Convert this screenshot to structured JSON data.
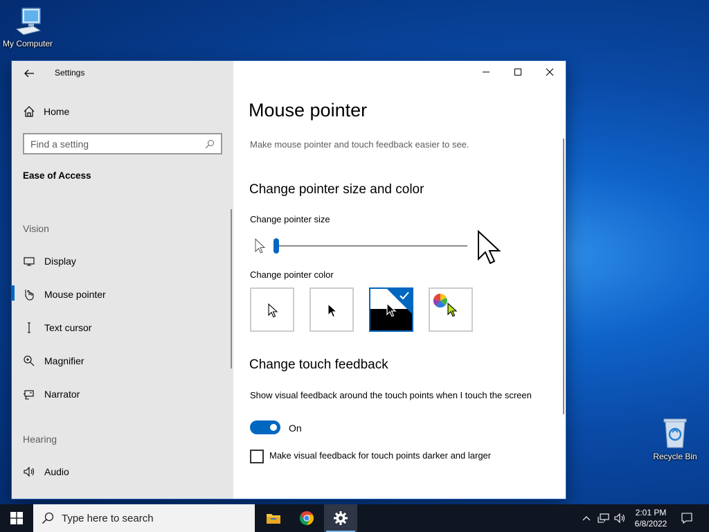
{
  "desktop": {
    "icons": [
      {
        "label": "My Computer"
      },
      {
        "label": "Recycle Bin"
      }
    ]
  },
  "window": {
    "title": "Settings",
    "controls": {
      "minimize": "minimize",
      "maximize": "maximize",
      "close": "close"
    }
  },
  "sidebar": {
    "home_label": "Home",
    "search_placeholder": "Find a setting",
    "category": "Ease of Access",
    "groups": [
      {
        "header": "Vision",
        "items": [
          {
            "label": "Display",
            "icon": "display-icon"
          },
          {
            "label": "Mouse pointer",
            "icon": "mouse-pointer-icon",
            "selected": true
          },
          {
            "label": "Text cursor",
            "icon": "text-cursor-icon"
          },
          {
            "label": "Magnifier",
            "icon": "magnifier-icon"
          },
          {
            "label": "Narrator",
            "icon": "narrator-icon"
          }
        ]
      },
      {
        "header": "Hearing",
        "items": [
          {
            "label": "Audio",
            "icon": "audio-icon"
          }
        ]
      }
    ]
  },
  "content": {
    "title": "Mouse pointer",
    "subtitle": "Make mouse pointer and touch feedback easier to see.",
    "section_size_color": {
      "header": "Change pointer size and color",
      "size_label": "Change pointer size",
      "size_value": 1,
      "color_label": "Change pointer color",
      "color_options": [
        "white",
        "black",
        "inverted",
        "custom"
      ],
      "selected_color": "inverted"
    },
    "section_touch": {
      "header": "Change touch feedback",
      "feedback_label": "Show visual feedback around the touch points when I touch the screen",
      "toggle_state": "On",
      "darker_label": "Make visual feedback for touch points darker and larger",
      "darker_checked": false
    }
  },
  "taskbar": {
    "search_placeholder": "Type here to search",
    "time": "2:01 PM",
    "date": "6/8/2022",
    "accent_color": "#0067c0"
  }
}
